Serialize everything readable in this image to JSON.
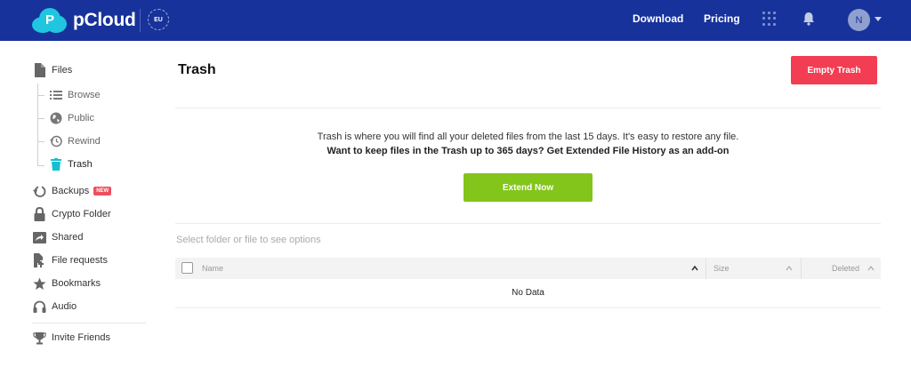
{
  "header": {
    "brand": "pCloud",
    "region_badge": "EU",
    "nav": {
      "download": "Download",
      "pricing": "Pricing"
    },
    "user_initial": "N",
    "colors": {
      "bar": "#17329b",
      "logo_cloud": "#20c5e0"
    }
  },
  "sidebar": {
    "files": {
      "label": "Files",
      "icon": "file-icon"
    },
    "sub_items": [
      {
        "label": "Browse",
        "icon": "list-icon"
      },
      {
        "label": "Public",
        "icon": "globe-icon"
      },
      {
        "label": "Rewind",
        "icon": "history-icon"
      },
      {
        "label": "Trash",
        "icon": "trash-icon",
        "active": true
      }
    ],
    "items": [
      {
        "label": "Backups",
        "icon": "backup-icon",
        "badge": "NEW"
      },
      {
        "label": "Crypto Folder",
        "icon": "lock-icon"
      },
      {
        "label": "Shared",
        "icon": "share-icon"
      },
      {
        "label": "File requests",
        "icon": "file-request-icon"
      },
      {
        "label": "Bookmarks",
        "icon": "star-icon"
      },
      {
        "label": "Audio",
        "icon": "headphones-icon"
      }
    ],
    "invite": {
      "label": "Invite Friends",
      "icon": "trophy-icon"
    }
  },
  "main": {
    "title": "Trash",
    "empty_button": "Empty Trash",
    "info_line": "Trash is where you will find all your deleted files from the last 15 days. It's easy to restore any file.",
    "upsell_line": "Want to keep files in the Trash up to 365 days? Get Extended File History as an add-on",
    "extend_button": "Extend Now",
    "select_hint": "Select folder or file to see options",
    "table": {
      "columns": {
        "name": "Name",
        "size": "Size",
        "deleted": "Deleted"
      },
      "empty_text": "No Data"
    },
    "colors": {
      "danger": "#f23d53",
      "success": "#83c51a",
      "accent": "#17bed3"
    }
  }
}
